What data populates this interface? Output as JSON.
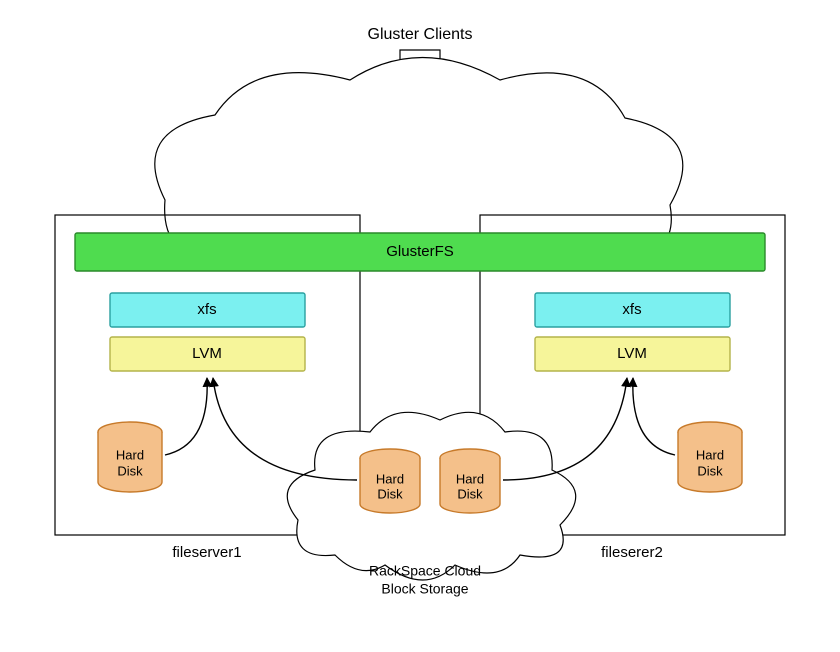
{
  "title": "Gluster Clients",
  "glusterfs_label": "GlusterFS",
  "servers": {
    "left": {
      "name": "fileserver1",
      "fs": "xfs",
      "vm": "LVM",
      "disk_line1": "Hard",
      "disk_line2": "Disk"
    },
    "right": {
      "name": "fileserer2",
      "fs": "xfs",
      "vm": "LVM",
      "disk_line1": "Hard",
      "disk_line2": "Disk"
    }
  },
  "cloud": {
    "line1": "RackSpace Cloud",
    "line2": "Block Storage",
    "disk1_line1": "Hard",
    "disk1_line2": "Disk",
    "disk2_line1": "Hard",
    "disk2_line2": "Disk"
  },
  "colors": {
    "glusterfs_fill": "#4fdc4f",
    "glusterfs_stroke": "#2a8a2a",
    "fs_fill": "#7bf0f0",
    "fs_stroke": "#2aa0a0",
    "lvm_fill": "#f6f59a",
    "lvm_stroke": "#b4b34a",
    "disk_fill": "#f4c08a",
    "disk_stroke": "#c77a2a",
    "line": "#000000"
  }
}
